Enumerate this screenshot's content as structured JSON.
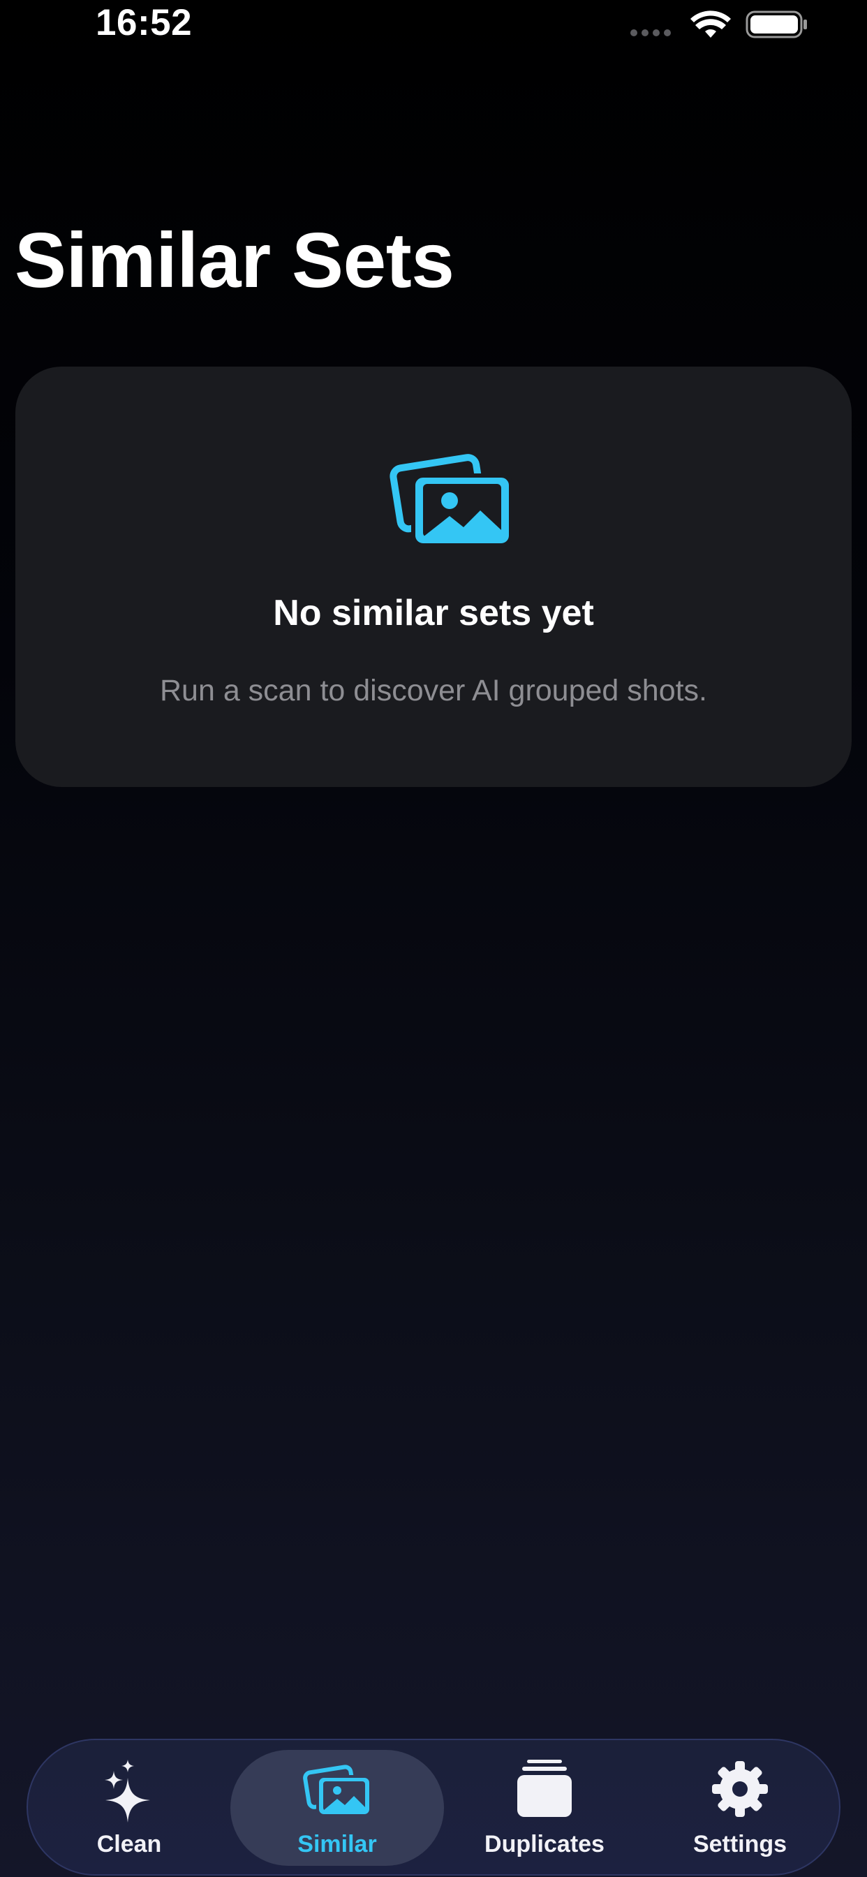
{
  "status_bar": {
    "time": "16:52"
  },
  "page": {
    "title": "Similar Sets"
  },
  "empty_state": {
    "icon": "photo-stack-icon",
    "title": "No similar sets yet",
    "subtitle": "Run a scan to discover AI grouped shots."
  },
  "tab_bar": {
    "active_tab": "similar",
    "tabs": [
      {
        "id": "clean",
        "label": "Clean",
        "icon": "sparkles-icon"
      },
      {
        "id": "similar",
        "label": "Similar",
        "icon": "photo-stack-icon"
      },
      {
        "id": "duplicates",
        "label": "Duplicates",
        "icon": "stack-icon"
      },
      {
        "id": "settings",
        "label": "Settings",
        "icon": "gear-icon"
      }
    ]
  },
  "colors": {
    "accent": "#34c6f4",
    "card_background": "#1a1b1f",
    "secondary_text": "#8e8e93",
    "tab_bar_background": "#1c2140",
    "active_tab_background": "#363c57"
  }
}
